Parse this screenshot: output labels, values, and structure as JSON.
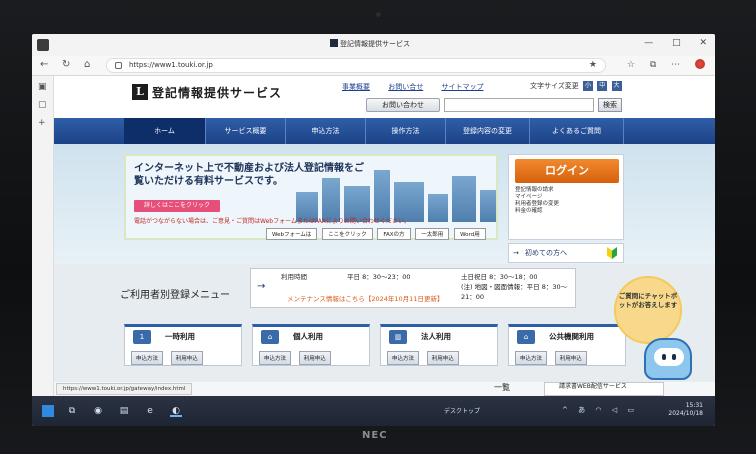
{
  "browser": {
    "tab_title": "登記情報提供サービス",
    "url": "https://www1.touki.or.jp"
  },
  "site": {
    "logo_text": "登記情報提供サービス",
    "header_links": [
      "事業概要",
      "お問い合せ",
      "サイトマップ"
    ],
    "font_size_label": "文字サイズ変更",
    "contact_button": "お問い合わせ",
    "search_button": "検索",
    "nav": [
      "ホーム",
      "サービス概要",
      "申込方法",
      "操作方法",
      "登録内容の変更",
      "よくあるご質問"
    ],
    "hero_title": "インターネット上で不動産および法人登記情報をご覧いただける有料サービスです。",
    "detail_button": "詳しくはここをクリック",
    "notice": "電話がつながらない場合は、ご意見・ご質問はWebフォームまたはFAXによりお問い合わせください。",
    "notice_links": [
      "Webフォームは",
      "ここをクリック",
      "FAXの方",
      "一太郎用",
      "Word用"
    ],
    "login_button": "ログイン",
    "login_list": [
      "登記情報の請求",
      "マイページ",
      "利用者登録の変更",
      "料金の確認"
    ],
    "first_time": "初めての方へ",
    "menu_title": "ご利用者別登録メニュー",
    "hours": {
      "label": "利用時間",
      "weekday": "平日 8：30～23：00",
      "holiday": "土日祝日 8：30～18：00",
      "land": "(注) 地図・図面情報：平日 8：30～21：00",
      "maintenance": "メンテナンス情報はこちら【2024年10月11日更新】"
    },
    "cards": [
      {
        "title": "一時利用",
        "buttons": [
          "申込方法",
          "利用申込"
        ]
      },
      {
        "title": "個人利用",
        "buttons": [
          "申込方法",
          "利用申込"
        ]
      },
      {
        "title": "法人利用",
        "buttons": [
          "申込方法",
          "利用申込"
        ]
      },
      {
        "title": "公共機関利用",
        "buttons": [
          "申込方法",
          "利用申込"
        ]
      }
    ],
    "chatbot": "ご質問にチャットボットがお答えします",
    "status_url": "https://www1.touki.or.jp/gateway/index.html",
    "ichiran": "一覧",
    "ws_text": "請求書WEB配信サービス"
  },
  "taskbar": {
    "desktop": "デスクトップ",
    "time": "15:31",
    "date": "2024/10/18"
  },
  "brand": "NEC"
}
